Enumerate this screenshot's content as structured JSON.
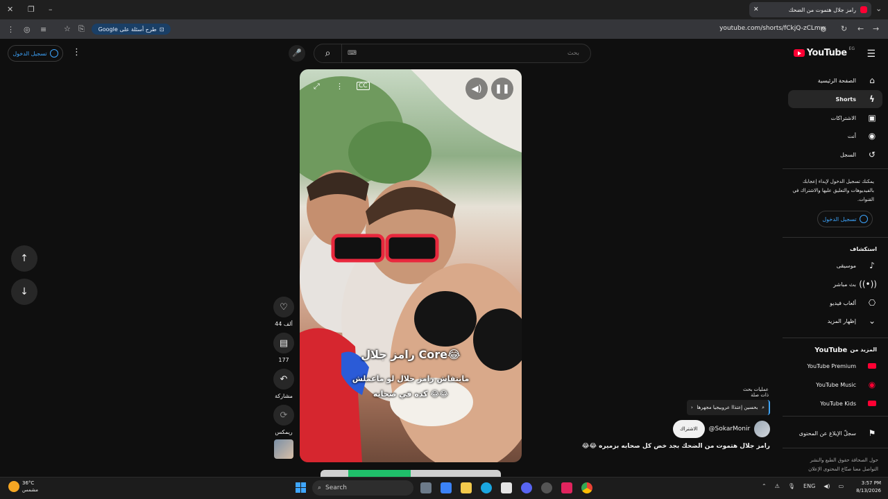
{
  "browser": {
    "tab_title": "رامز جلال هتموت من الضحك",
    "url": "youtube.com/shorts/fCkjQ-zCLmw",
    "google_chip": "طرح أسئلة على Google"
  },
  "header": {
    "signin": "تسجيل الدخول",
    "search_placeholder": "بحث",
    "logo_text": "YouTube",
    "logo_region": "EG"
  },
  "sidebar": {
    "items": [
      {
        "label": "الصفحة الرئيسية",
        "icon": "home-icon"
      },
      {
        "label": "Shorts",
        "icon": "shorts-icon"
      },
      {
        "label": "الاشتراكات",
        "icon": "subscriptions-icon"
      },
      {
        "label": "أنت",
        "icon": "you-icon"
      },
      {
        "label": "السجل",
        "icon": "history-icon"
      }
    ],
    "signin_msg": "يمكنك تسجيل الدخول لإبداء إعجابك بالفيديوهات والتعليق عليها والاشتراك في القنوات.",
    "signin_btn": "تسجيل الدخول",
    "explore_title": "استكشاف",
    "explore": [
      {
        "label": "موسيقى",
        "icon": "music-icon"
      },
      {
        "label": "بث مباشر",
        "icon": "live-icon"
      },
      {
        "label": "ألعاب فيديو",
        "icon": "gaming-icon"
      },
      {
        "label": "إظهار المزيد",
        "icon": "chevron-down-icon"
      }
    ],
    "more_title_prefix": "المزيد من",
    "more_title_brand": "YouTube",
    "more": [
      {
        "label": "YouTube Premium"
      },
      {
        "label": "YouTube Music"
      },
      {
        "label": "YouTube Kids"
      }
    ],
    "report": "سجلّ الإبلاغ عن المحتوى",
    "footer_line1": "حول  الصحافة  حقوق الطبع والنشر",
    "footer_line2": "التواصل معنا  صنّاع المحتوى  الإعلان"
  },
  "player": {
    "caption_title": "رامز جلال Core😂",
    "caption_line1": "مايتفاش رامز جلال لو ماعملش",
    "caption_line2": "كده في صحابه 😂😂"
  },
  "actions": {
    "likes": "44 ألف",
    "comments": "177",
    "share": "مشاركة",
    "remix": "ريمكس"
  },
  "info": {
    "search_hint_title": "عمليات بحث ذات صلة",
    "search_hint": "بحسين إعتذاا عروبيجيا مجهرها",
    "channel": "@SokarMonir",
    "subscribe": "الاشتراك",
    "title": "رامز جلال هتموت من الضحك بجد خض كل صحابه بزميره 😂😂"
  },
  "taskbar": {
    "temp": "36°C",
    "weather": "مشمس",
    "search": "Search",
    "lang": "ENG",
    "time": "3:57 PM",
    "date": "8/13/2026"
  }
}
